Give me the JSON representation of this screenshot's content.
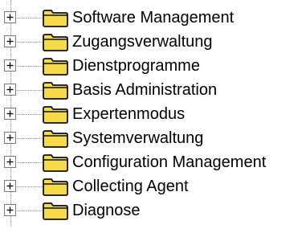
{
  "tree": {
    "items": [
      {
        "label": "Software Management",
        "icon": "folder-icon",
        "expander": "plus"
      },
      {
        "label": "Zugangsverwaltung",
        "icon": "folder-icon",
        "expander": "plus"
      },
      {
        "label": "Dienstprogramme",
        "icon": "folder-icon",
        "expander": "plus"
      },
      {
        "label": "Basis Administration",
        "icon": "folder-icon",
        "expander": "plus"
      },
      {
        "label": "Expertenmodus",
        "icon": "folder-icon",
        "expander": "plus"
      },
      {
        "label": "Systemverwaltung",
        "icon": "folder-icon",
        "expander": "plus"
      },
      {
        "label": "Configuration Management",
        "icon": "folder-icon",
        "expander": "plus"
      },
      {
        "label": "Collecting Agent",
        "icon": "folder-icon",
        "expander": "plus"
      },
      {
        "label": "Diagnose",
        "icon": "folder-icon",
        "expander": "plus"
      }
    ]
  },
  "colors": {
    "folder_fill": "#f5da4a",
    "folder_stroke": "#111111",
    "expander_border": "#7a7a7a",
    "tree_lines": "#8a8a8a",
    "text": "#000000"
  }
}
